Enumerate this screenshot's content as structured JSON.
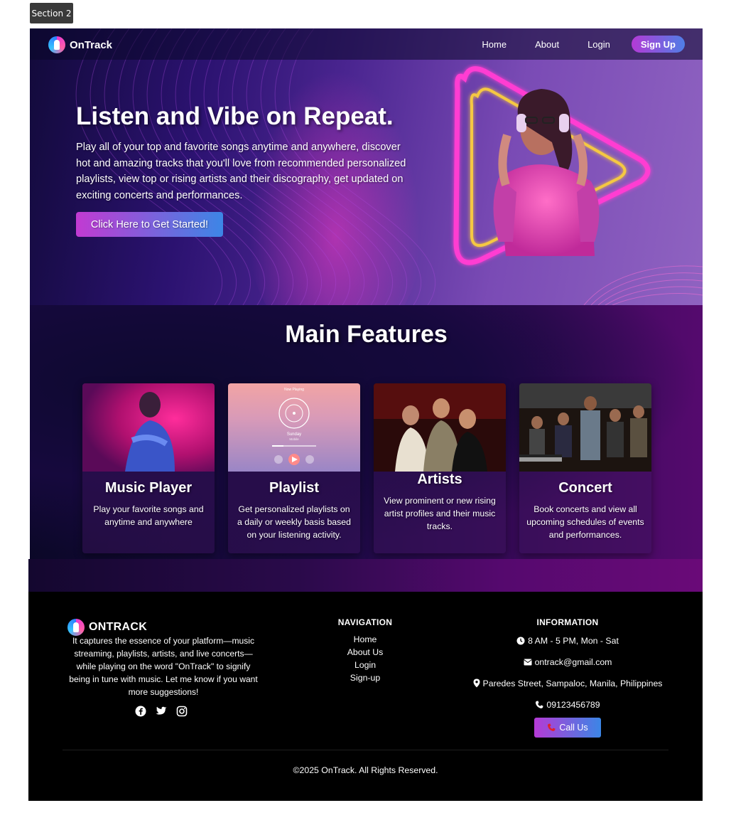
{
  "section_tag": "Section 2",
  "nav": {
    "logo": "OnTrack",
    "links": [
      "Home",
      "About",
      "Login"
    ],
    "signup": "Sign Up"
  },
  "hero": {
    "title": "Listen and Vibe on Repeat.",
    "description": "Play all of your top and favorite songs anytime and anywhere, discover hot and amazing tracks that you'll love from recommended personalized playlists, view top or rising artists and their discography, get updated on exciting concerts and performances.",
    "cta": "Click Here to Get Started!"
  },
  "features": {
    "title": "Main Features",
    "cards": [
      {
        "title": "Music Player",
        "desc": "Play your favorite songs and anytime and anywhere"
      },
      {
        "title": "Playlist",
        "desc": "Get personalized playlists on a daily or weekly basis based on your listening activity.",
        "mock": {
          "header": "Now Playing",
          "song": "Sunday",
          "artist": "Mobile"
        }
      },
      {
        "title": "Artists",
        "desc": "View prominent or new rising artist profiles and their music tracks."
      },
      {
        "title": "Concert",
        "desc": "Book concerts and view all upcoming schedules of events and performances."
      }
    ]
  },
  "footer": {
    "logo": "ONTRACK",
    "about": "It captures the essence of your platform—music streaming, playlists, artists, and live concerts—while playing on the word \"OnTrack\" to signify being in tune with music. Let me know if you want more suggestions!",
    "socials": [
      "facebook-icon",
      "twitter-icon",
      "instagram-icon"
    ],
    "navigation": {
      "heading": "NAVIGATION",
      "items": [
        "Home",
        "About Us",
        "Login",
        "Sign-up"
      ]
    },
    "information": {
      "heading": "INFORMATION",
      "hours": "8 AM - 5 PM, Mon - Sat",
      "email": "ontrack@gmail.com",
      "address": "Paredes Street, Sampaloc, Manila, Philippines",
      "phone": "09123456789",
      "call_button": "Call Us"
    },
    "copyright": "©2025 OnTrack. All Rights Reserved."
  },
  "colors": {
    "accent_gradient_start": "#b43ad6",
    "accent_gradient_end": "#3c86e6",
    "footer_bg": "#000000",
    "neon_pink": "#ff3cd2",
    "neon_yellow": "#f5c842"
  }
}
